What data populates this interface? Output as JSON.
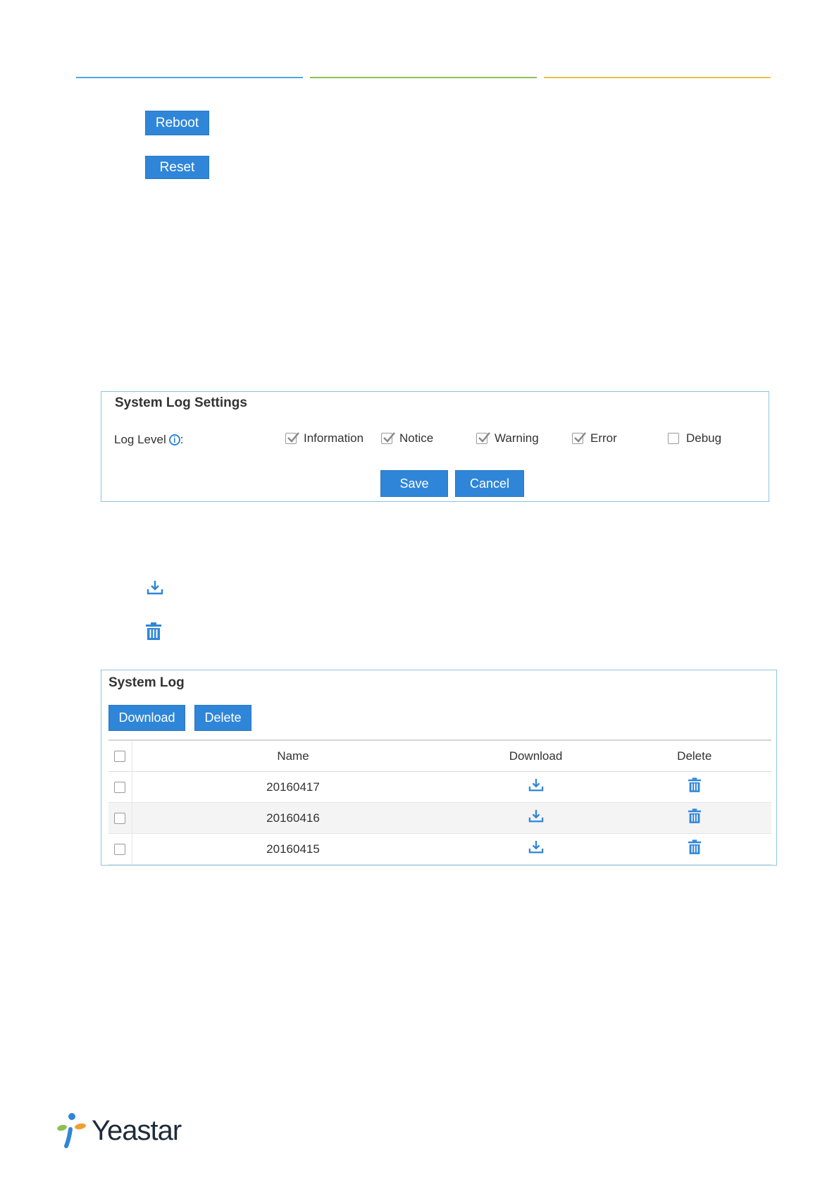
{
  "header": {
    "line_colors": [
      "#4fa6dd",
      "#8cc152",
      "#e6c14a"
    ]
  },
  "buttons": {
    "reboot": "Reboot",
    "reset": "Reset"
  },
  "settings_panel": {
    "title": "System Log Settings",
    "log_level_label": "Log Level",
    "colon": ":",
    "options": [
      {
        "label": "Information",
        "checked": true
      },
      {
        "label": "Notice",
        "checked": true
      },
      {
        "label": "Warning",
        "checked": true
      },
      {
        "label": "Error",
        "checked": true
      },
      {
        "label": "Debug",
        "checked": false
      }
    ],
    "save": "Save",
    "cancel": "Cancel"
  },
  "log_panel": {
    "title": "System Log",
    "download_button": "Download",
    "delete_button": "Delete",
    "columns": [
      "Name",
      "Download",
      "Delete"
    ],
    "rows": [
      {
        "name": "20160417"
      },
      {
        "name": "20160416"
      },
      {
        "name": "20160415"
      }
    ]
  },
  "footer": {
    "logo_text": "Yeastar"
  },
  "colors": {
    "accent": "#2f86d8",
    "panel_border": "#8ec3e0"
  }
}
